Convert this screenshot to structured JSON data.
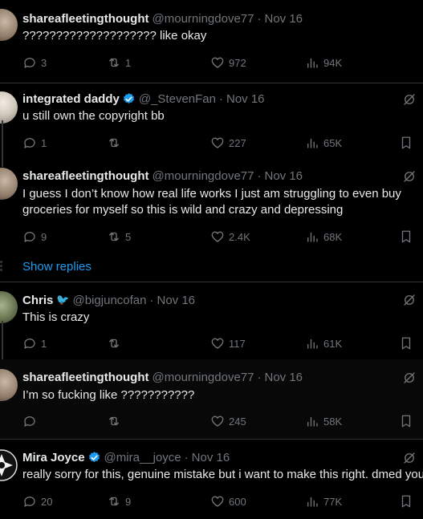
{
  "tweets": [
    {
      "name": "shareafleetingthought",
      "handle": "@mourningdove77",
      "time": "Nov 16",
      "verified": false,
      "text": "???????????????????? like okay",
      "replies": "3",
      "reposts": "1",
      "likes": "972",
      "views": "94K"
    },
    {
      "name": "integrated daddy",
      "handle": "@_StevenFan",
      "time": "Nov 16",
      "verified": true,
      "text": "u still own the copyright bb",
      "replies": "1",
      "reposts": "",
      "likes": "227",
      "views": "65K"
    },
    {
      "name": "shareafleetingthought",
      "handle": "@mourningdove77",
      "time": "Nov 16",
      "verified": false,
      "text": "I guess I don’t know how real life works I just am struggling to even buy groceries for myself so this is wild and crazy and depressing",
      "replies": "9",
      "reposts": "5",
      "likes": "2.4K",
      "views": "68K"
    },
    {
      "name": "Chris",
      "handle": "@bigjuncofan",
      "time": "Nov 16",
      "verified": false,
      "text": "This is crazy",
      "replies": "1",
      "reposts": "",
      "likes": "117",
      "views": "61K"
    },
    {
      "name": "shareafleetingthought",
      "handle": "@mourningdove77",
      "time": "Nov 16",
      "verified": false,
      "text": "I’m so fucking like ???????????",
      "replies": "",
      "reposts": "",
      "likes": "245",
      "views": "58K"
    },
    {
      "name": "Mira Joyce",
      "handle": "@mira__joyce",
      "time": "Nov 16",
      "verified": true,
      "text": "really sorry for this, genuine mistake but i want to make this right. dmed you",
      "replies": "20",
      "reposts": "9",
      "likes": "600",
      "views": "77K"
    }
  ],
  "show_replies_label": "Show replies",
  "icons": {
    "reply": "reply-icon",
    "repost": "repost-icon",
    "like": "heart-icon",
    "views": "views-icon",
    "bookmark": "bookmark-icon",
    "grok": "grok-icon",
    "verified": "verified-badge-icon"
  },
  "colors": {
    "background": "#000000",
    "text": "#e7e9ea",
    "muted": "#71767b",
    "link": "#1d9bf0",
    "verified": "#1d9bf0",
    "divider": "#2f3336"
  }
}
